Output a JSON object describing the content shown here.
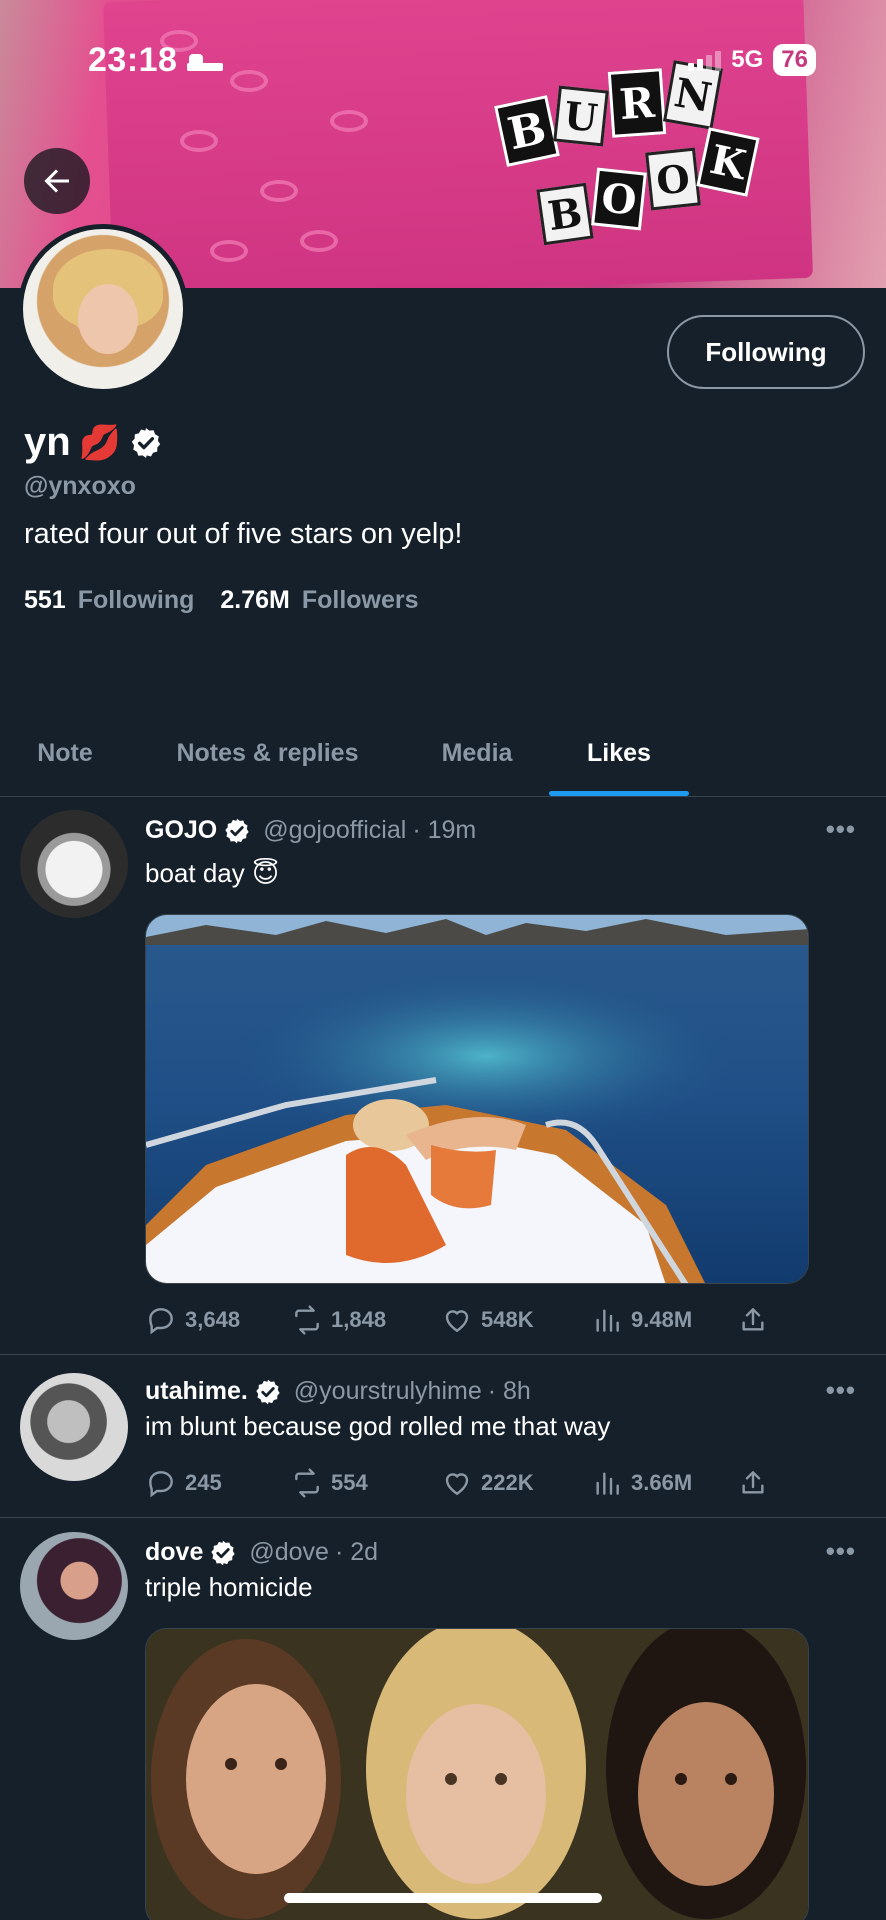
{
  "status_bar": {
    "time": "23:18",
    "network": "5G",
    "battery": "76"
  },
  "banner": {
    "book_title_line1": [
      "B",
      "U",
      "R",
      "N"
    ],
    "book_title_line2": [
      "B",
      "O",
      "O",
      "K"
    ]
  },
  "profile": {
    "display_name": "yn",
    "emoji": "💋",
    "handle": "@ynxoxo",
    "bio": "rated four out of five stars on yelp!",
    "following_count": "551",
    "following_label": "Following",
    "followers_count": "2.76M",
    "followers_label": "Followers",
    "follow_button": "Following"
  },
  "tabs": [
    {
      "label": "Note",
      "active": false
    },
    {
      "label": "Notes & replies",
      "active": false
    },
    {
      "label": "Media",
      "active": false
    },
    {
      "label": "Likes",
      "active": true
    }
  ],
  "tweets": [
    {
      "name": "GOJO",
      "handle": "@gojoofficial",
      "time": "· 19m",
      "text": "boat day 😇",
      "replies": "3,648",
      "retweets": "1,848",
      "likes": "548K",
      "views": "9.48M"
    },
    {
      "name": "utahime.",
      "handle": "@yourstrulyhime",
      "time": "· 8h",
      "text": "im blunt because god rolled me that way",
      "replies": "245",
      "retweets": "554",
      "likes": "222K",
      "views": "3.66M"
    },
    {
      "name": "dove",
      "handle": "@dove",
      "time": "· 2d",
      "text": "triple homicide"
    }
  ],
  "more_icon": "•••",
  "colors": {
    "background": "#15202b",
    "accent": "#1d9bf0",
    "muted": "#8b98a5",
    "divider": "#38444d"
  }
}
